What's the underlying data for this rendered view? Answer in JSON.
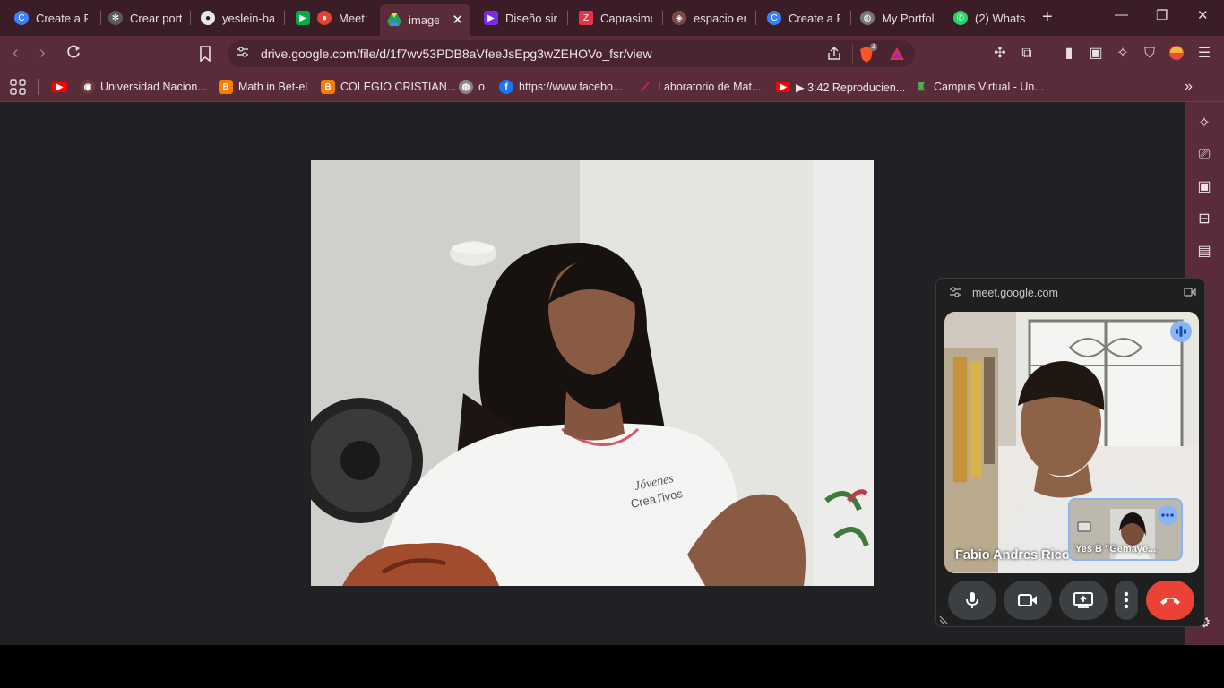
{
  "tabs": [
    {
      "label": "Create a P",
      "icon": "create-icon",
      "color": "#3b82f6"
    },
    {
      "label": "Crear port",
      "icon": "chatgpt-icon",
      "color": "#cfcfcf"
    },
    {
      "label": "yeslein-ba",
      "icon": "github-icon",
      "color": "#e8e8e8"
    },
    {
      "label": "Meet:",
      "icon": "meet-icon",
      "color": "#00ac47"
    },
    {
      "label": "image",
      "icon": "drive-icon",
      "color": "#1fa463"
    },
    {
      "label": "Diseño sin",
      "icon": "canva-icon",
      "color": "#7d2ae8"
    },
    {
      "label": "Caprasimo",
      "icon": "font-icon",
      "color": "#e6334a"
    },
    {
      "label": "espacio en",
      "icon": "brave-icon",
      "color": "#fb542b"
    },
    {
      "label": "Create a P",
      "icon": "create-icon",
      "color": "#3b82f6"
    },
    {
      "label": "My Portfol",
      "icon": "globe-icon",
      "color": "#bbbbbb"
    },
    {
      "label": "(2) Whats",
      "icon": "whatsapp-icon",
      "color": "#25d366"
    }
  ],
  "address_bar": {
    "url": "drive.google.com/file/d/1f7wv53PDB8aVfeeJsEpg3wZEHOVo_fsr/view",
    "brave_badge": "4"
  },
  "bookmarks": [
    {
      "label": "",
      "icon": "youtube-icon",
      "color": "#ff0000"
    },
    {
      "label": "Universidad Nacion...",
      "icon": "university-icon",
      "color": "#6b3a3a"
    },
    {
      "label": "Math in Bet-el",
      "icon": "blogger-icon",
      "color": "#f57d00"
    },
    {
      "label": "COLEGIO CRISTIAN...",
      "icon": "blogger-icon",
      "color": "#f57d00"
    },
    {
      "label": "o",
      "icon": "globe-icon",
      "color": "#888888"
    },
    {
      "label": "https://www.facebo...",
      "icon": "facebook-icon",
      "color": "#1877f2"
    },
    {
      "label": "Laboratorio de Mat...",
      "icon": "wand-icon",
      "color": "#c2185b"
    },
    {
      "label": "▶ 3:42 Reproducien...",
      "icon": "youtube-icon",
      "color": "#ff0000"
    },
    {
      "label": "Campus Virtual - Un...",
      "icon": "campus-icon",
      "color": "#4caf50"
    }
  ],
  "photo": {
    "shirt_text_line1": "Jóvenes",
    "shirt_text_line2": "CreaTivos"
  },
  "meet_pip": {
    "domain": "meet.google.com",
    "main_participant": "Fabio Andres Rico",
    "self_tile_name": "Yes B \"Gemaye..."
  }
}
